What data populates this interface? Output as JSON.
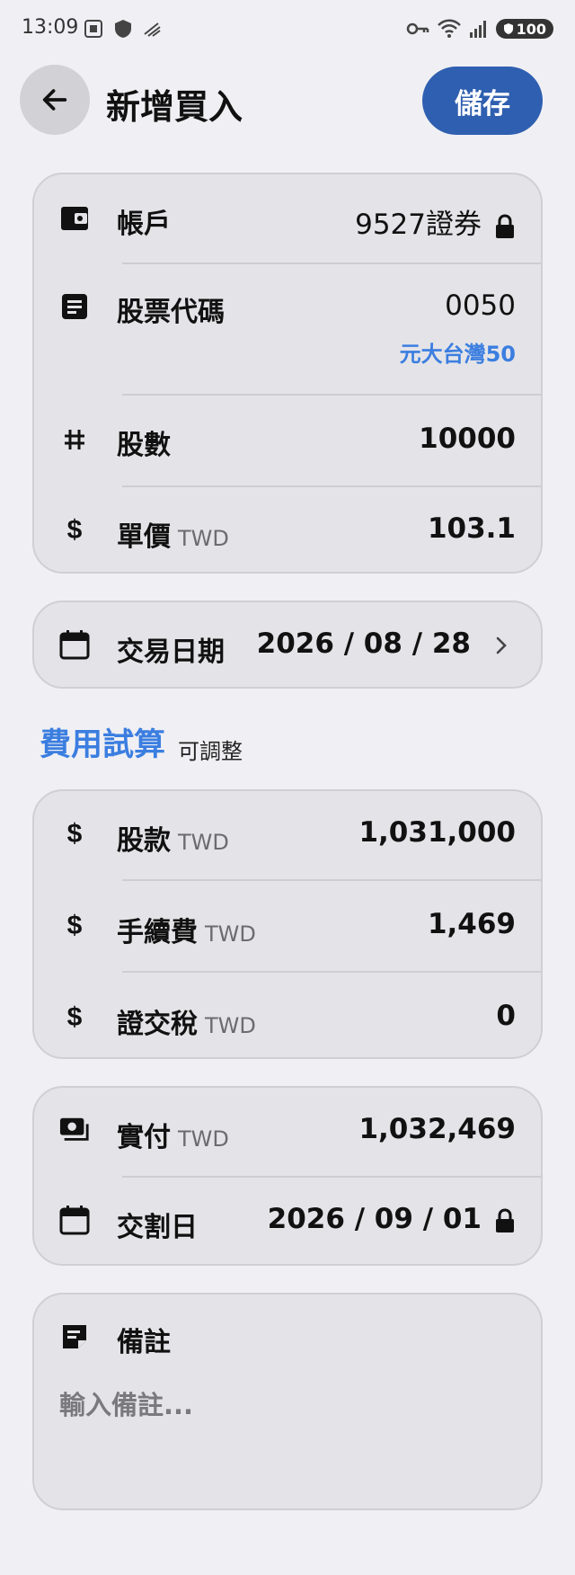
{
  "status": {
    "time": "13:09",
    "battery": "100"
  },
  "header": {
    "title": "新增買入",
    "save_label": "儲存"
  },
  "account": {
    "label": "帳戶",
    "value": "9527證券"
  },
  "stock_code": {
    "label": "股票代碼",
    "value": "0050",
    "name": "元大台灣50"
  },
  "shares": {
    "label": "股數",
    "value": "10000"
  },
  "unit_price": {
    "label": "單價",
    "unit": "TWD",
    "value": "103.1"
  },
  "trade_date": {
    "label": "交易日期",
    "value": "2026 / 08 / 28"
  },
  "fees": {
    "title": "費用試算",
    "subtitle": "可調整",
    "amount": {
      "label": "股款",
      "unit": "TWD",
      "value": "1,031,000"
    },
    "commission": {
      "label": "手續費",
      "unit": "TWD",
      "value": "1,469"
    },
    "tax": {
      "label": "證交稅",
      "unit": "TWD",
      "value": "0"
    }
  },
  "payment": {
    "paid": {
      "label": "實付",
      "unit": "TWD",
      "value": "1,032,469"
    },
    "settlement": {
      "label": "交割日",
      "value": "2026 / 09 / 01"
    }
  },
  "notes": {
    "label": "備註",
    "placeholder": "輸入備註..."
  },
  "colors": {
    "accent": "#3b7ee0",
    "save_button": "#2f5fb0",
    "card": "#e4e4e8",
    "background": "#f0f0f4"
  }
}
